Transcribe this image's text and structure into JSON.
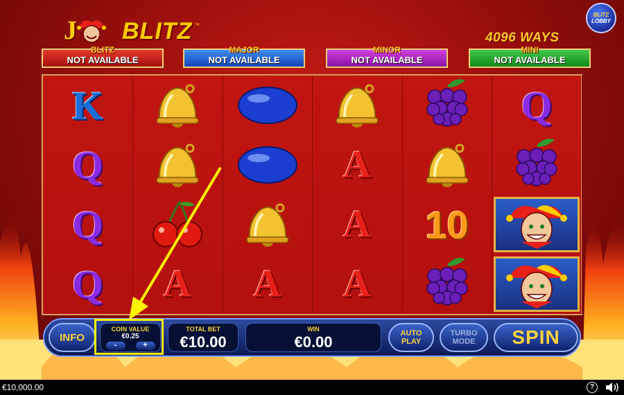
{
  "game": {
    "logo_letter": "J",
    "logo_word": "BLITZ",
    "logo_tm": "™",
    "ways": "4096 WAYS"
  },
  "lobby_button": {
    "line1": "BLITZ",
    "line2": "LOBBY"
  },
  "jackpots": [
    {
      "label": "BLITZ",
      "value": "NOT AVAILABLE",
      "color": "#c8201a"
    },
    {
      "label": "MAJOR",
      "value": "NOT AVAILABLE",
      "color": "#1a5fd0"
    },
    {
      "label": "MINOR",
      "value": "NOT AVAILABLE",
      "color": "#b01ec8"
    },
    {
      "label": "MINI",
      "value": "NOT AVAILABLE",
      "color": "#1fa42a"
    }
  ],
  "reels": [
    [
      "K",
      "Q",
      "Q",
      "Q"
    ],
    [
      "bell",
      "bell",
      "cherries",
      "A"
    ],
    [
      "plum",
      "plum",
      "bell",
      "A"
    ],
    [
      "bell",
      "A",
      "A",
      "A"
    ],
    [
      "grapes",
      "bell",
      "10",
      "grapes"
    ],
    [
      "Q",
      "grapes",
      "joker",
      "joker"
    ]
  ],
  "controls": {
    "info": "INFO",
    "coin_value_title": "COIN VALUE",
    "coin_value": "€0.25",
    "coin_minus": "-",
    "coin_plus": "+",
    "total_bet_title": "TOTAL BET",
    "total_bet": "€10.00",
    "win_title": "WIN",
    "win": "€0.00",
    "autoplay_line1": "AUTO",
    "autoplay_line2": "PLAY",
    "turbo_line1": "TURBO",
    "turbo_line2": "MODE",
    "spin": "SPIN"
  },
  "status_bar": {
    "balance": "€10,000.00",
    "help": "?"
  },
  "colors": {
    "highlight": "#fff200",
    "reel_bg": "#c11510",
    "accent": "#ffd23a"
  }
}
